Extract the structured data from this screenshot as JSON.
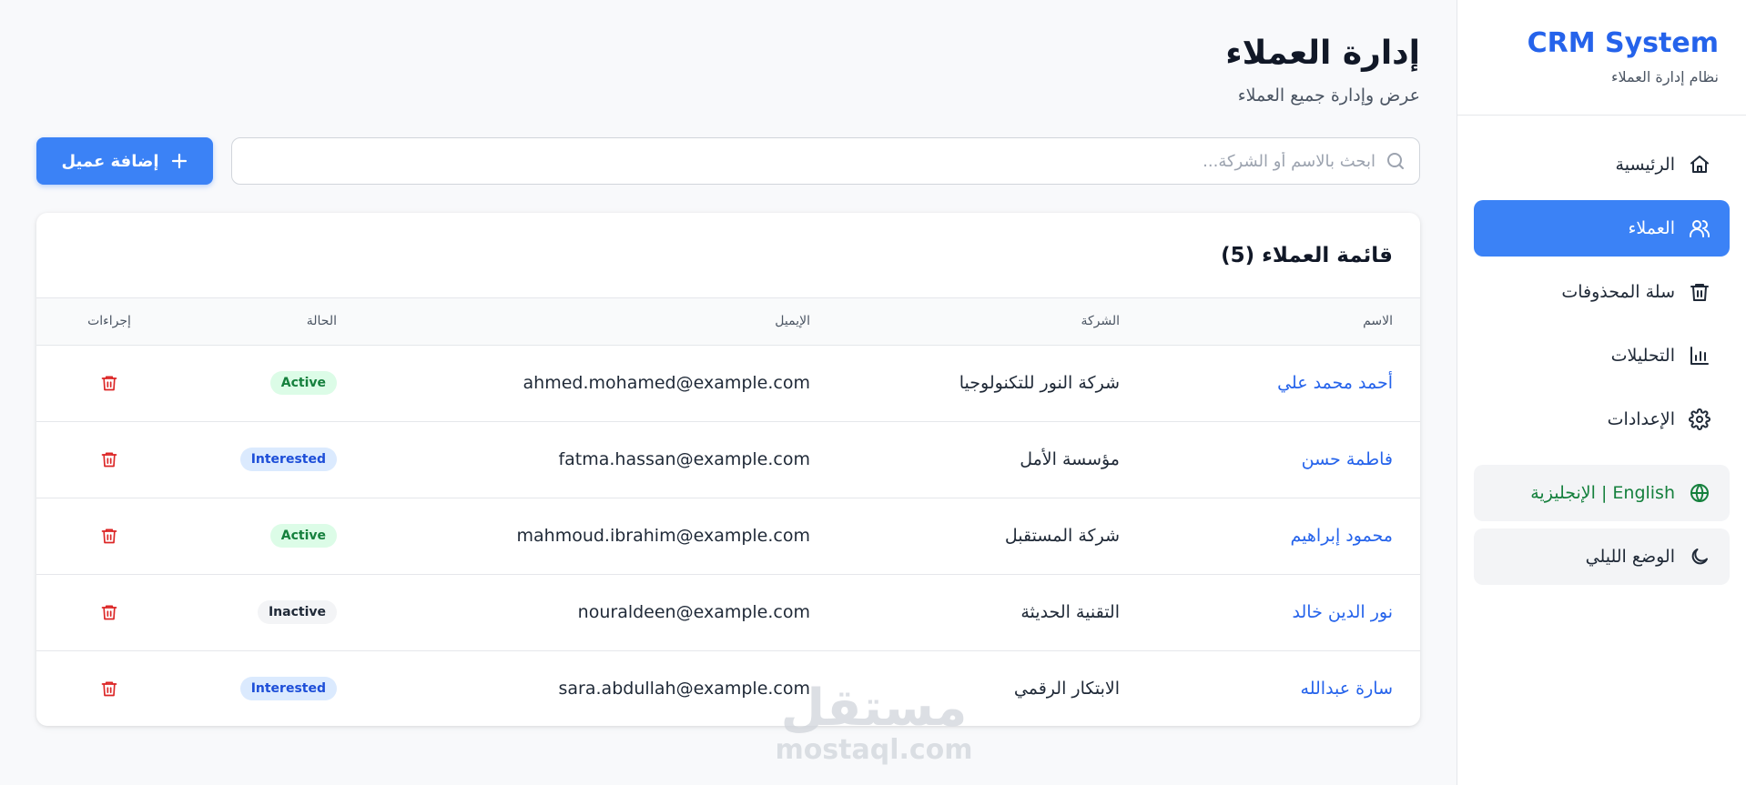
{
  "sidebar": {
    "brand_title": "CRM System",
    "brand_subtitle": "نظام إدارة العملاء",
    "items": [
      {
        "label": "الرئيسية",
        "icon": "home-icon"
      },
      {
        "label": "العملاء",
        "icon": "users-icon",
        "active": true
      },
      {
        "label": "سلة المحذوفات",
        "icon": "trash-icon"
      },
      {
        "label": "التحليلات",
        "icon": "bar-chart-icon"
      },
      {
        "label": "الإعدادات",
        "icon": "gear-icon"
      }
    ],
    "language_toggle": "English | الإنجليزية",
    "dark_mode_toggle": "الوضع الليلي"
  },
  "header": {
    "title": "إدارة العملاء",
    "subtitle": "عرض وإدارة جميع العملاء"
  },
  "search": {
    "placeholder": "ابحث بالاسم أو الشركة...",
    "value": ""
  },
  "toolbar": {
    "add_label": "إضافة عميل"
  },
  "table": {
    "title": "قائمة العملاء (5)",
    "columns": {
      "name": "الاسم",
      "company": "الشركة",
      "email": "الإيميل",
      "status": "الحالة",
      "actions": "إجراءات"
    },
    "rows": [
      {
        "name": "أحمد محمد علي",
        "company": "شركة النور للتكنولوجيا",
        "email": "ahmed.mohamed@example.com",
        "status": "Active"
      },
      {
        "name": "فاطمة حسن",
        "company": "مؤسسة الأمل",
        "email": "fatma.hassan@example.com",
        "status": "Interested"
      },
      {
        "name": "محمود إبراهيم",
        "company": "شركة المستقبل",
        "email": "mahmoud.ibrahim@example.com",
        "status": "Active"
      },
      {
        "name": "نور الدين خالد",
        "company": "التقنية الحديثة",
        "email": "nouraldeen@example.com",
        "status": "Inactive"
      },
      {
        "name": "سارة عبدالله",
        "company": "الابتكار الرقمي",
        "email": "sara.abdullah@example.com",
        "status": "Interested"
      }
    ]
  },
  "watermark": {
    "arabic": "مستقل",
    "latin": "mostaql.com"
  },
  "colors": {
    "accent": "#3b82f6",
    "brand": "#2563eb",
    "danger": "#dc2626",
    "language": "#15803d"
  }
}
